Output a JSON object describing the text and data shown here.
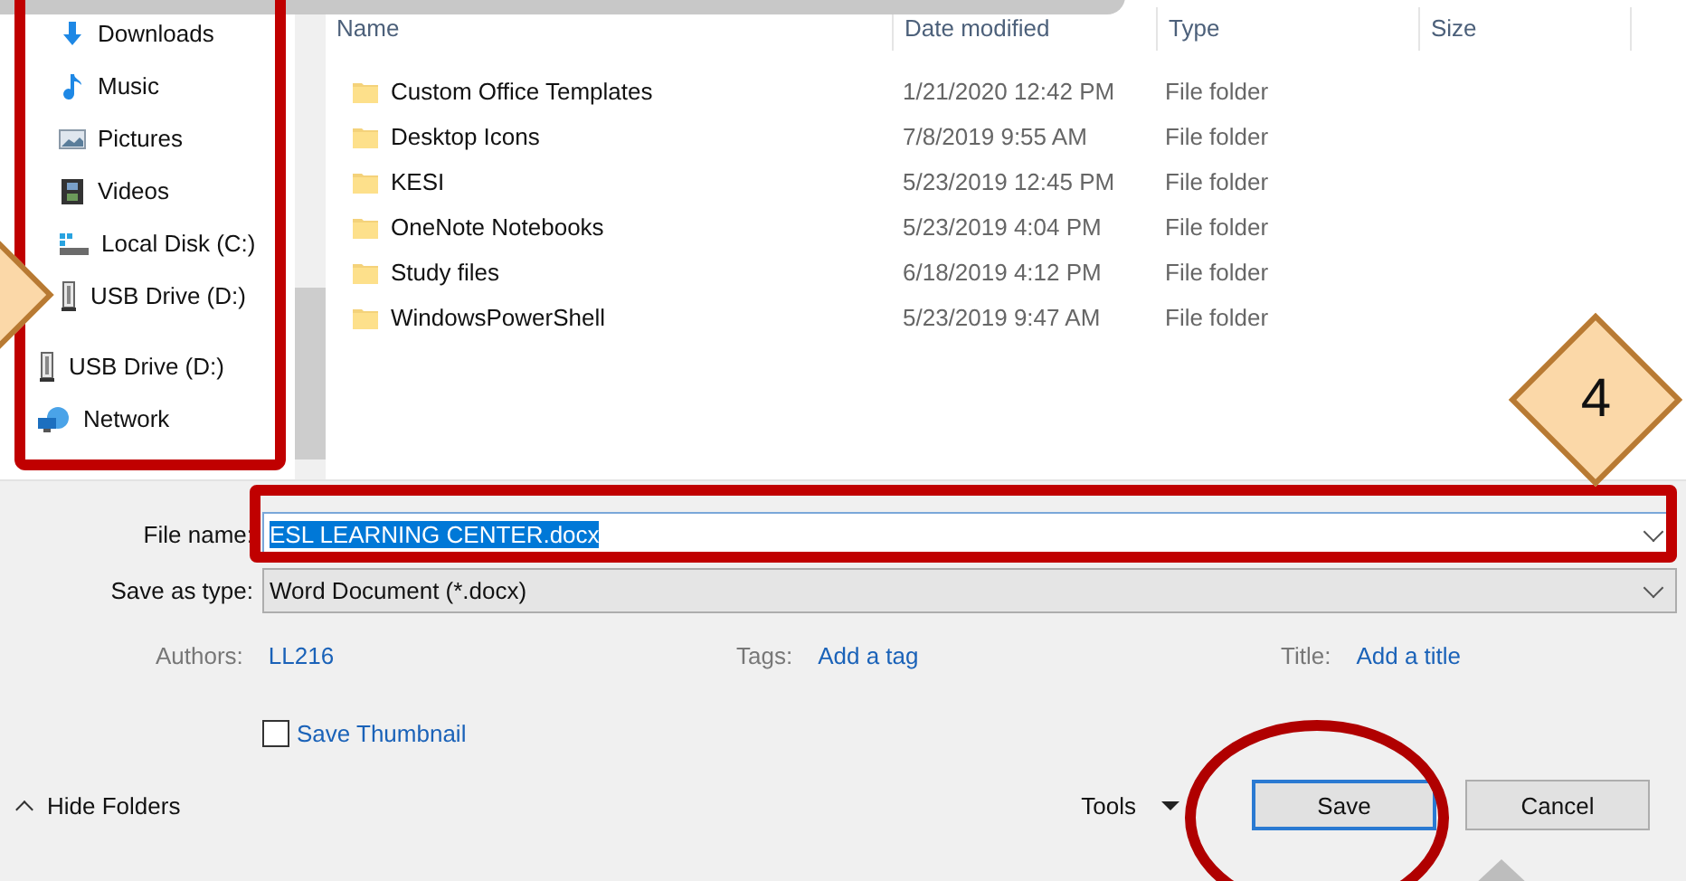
{
  "nav_pane": {
    "sections": [
      {
        "items": [
          {
            "label": "Downloads",
            "kind": "downloads"
          },
          {
            "label": "Music",
            "kind": "music"
          },
          {
            "label": "Pictures",
            "kind": "pictures"
          },
          {
            "label": "Videos",
            "kind": "videos"
          },
          {
            "label": "Local Disk (C:)",
            "kind": "disk"
          },
          {
            "label": "USB Drive (D:)",
            "kind": "usb"
          }
        ]
      },
      {
        "items": [
          {
            "label": "USB Drive (D:)",
            "kind": "usb"
          },
          {
            "label": "Network",
            "kind": "network"
          }
        ]
      }
    ]
  },
  "file_list": {
    "columns": [
      "Name",
      "Date modified",
      "Type",
      "Size"
    ],
    "rows": [
      {
        "name": "Custom Office Templates",
        "date": "1/21/2020 12:42 PM",
        "type": "File folder"
      },
      {
        "name": "Desktop Icons",
        "date": "7/8/2019 9:55 AM",
        "type": "File folder"
      },
      {
        "name": "KESI",
        "date": "5/23/2019 12:45 PM",
        "type": "File folder"
      },
      {
        "name": "OneNote Notebooks",
        "date": "5/23/2019 4:04 PM",
        "type": "File folder"
      },
      {
        "name": "Study files",
        "date": "6/18/2019 4:12 PM",
        "type": "File folder"
      },
      {
        "name": "WindowsPowerShell",
        "date": "5/23/2019 9:47 AM",
        "type": "File folder"
      }
    ]
  },
  "file_name": {
    "label": "File name:",
    "value": "ESL LEARNING CENTER.docx"
  },
  "save_as_type": {
    "label": "Save as type:",
    "value": "Word Document (*.docx)"
  },
  "properties": [
    {
      "label": "Authors:",
      "value": "LL216"
    },
    {
      "label": "Tags:",
      "value": "Add a tag"
    },
    {
      "label": "Title:",
      "value": "Add a title"
    }
  ],
  "save_thumbnail": {
    "label": "Save Thumbnail",
    "checked": false
  },
  "hide_folders": "Hide Folders",
  "tools": "Tools",
  "buttons": [
    {
      "label": "Save",
      "default": true
    },
    {
      "label": "Cancel",
      "default": false
    }
  ],
  "step_badge": "4"
}
